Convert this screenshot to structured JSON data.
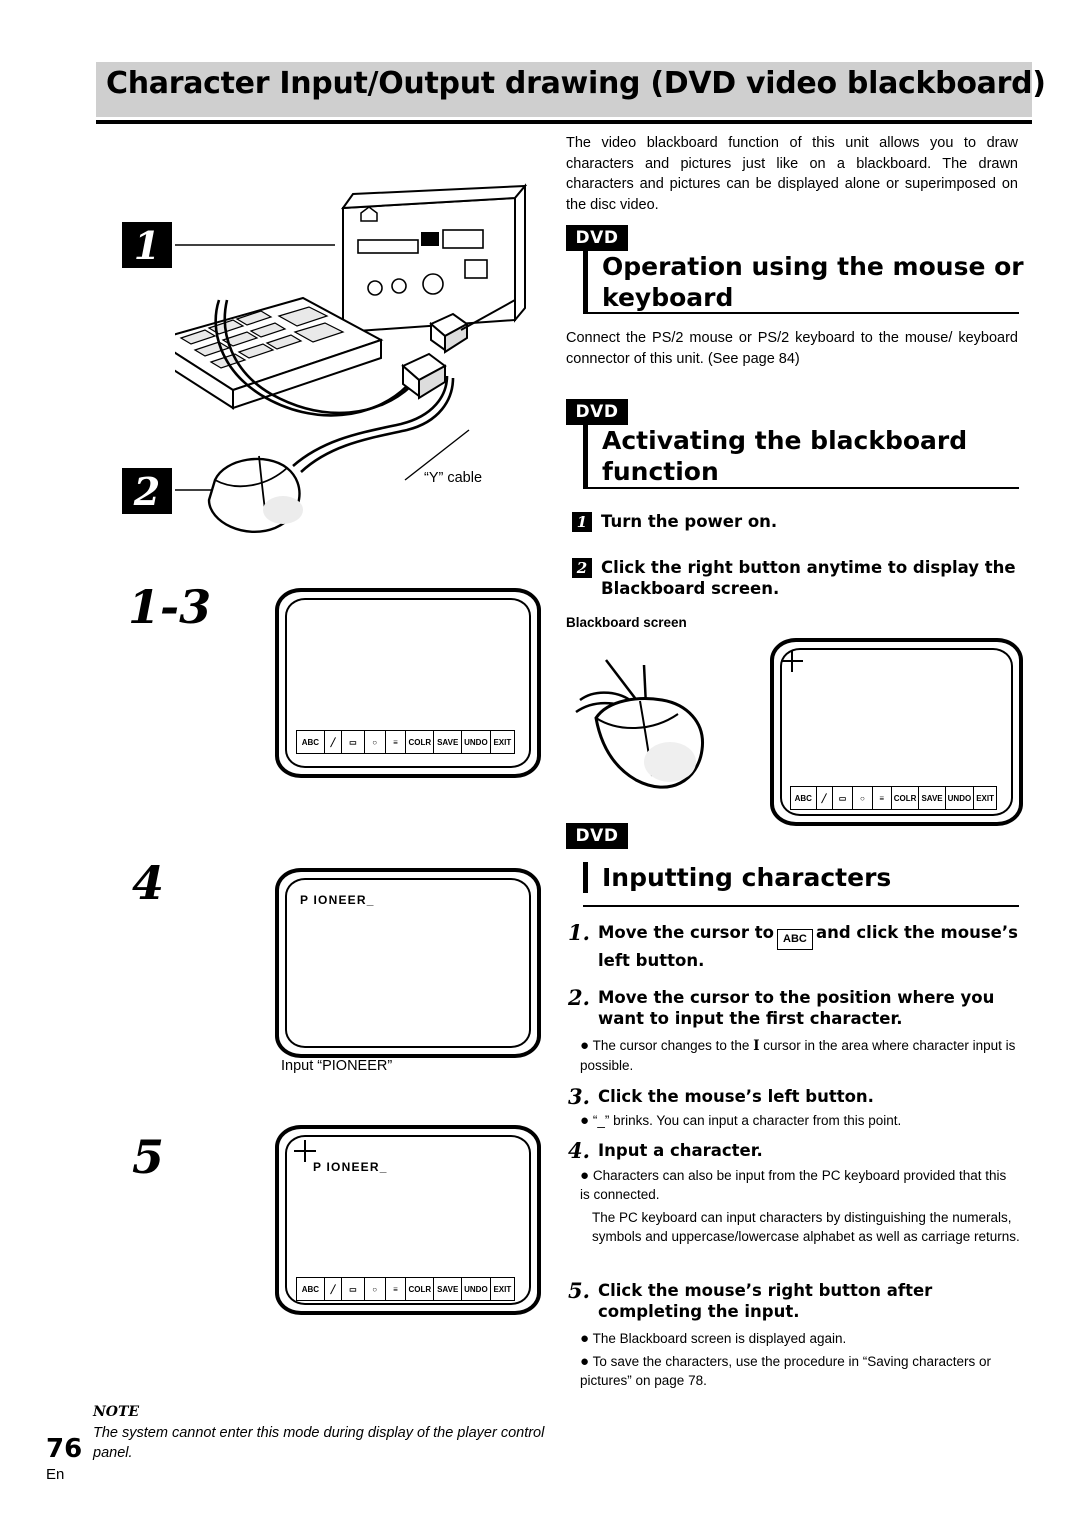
{
  "header": {
    "title": "Character Input/Output drawing (DVD video blackboard)"
  },
  "intro": "The video blackboard function of this unit allows you to draw characters and pictures just like on a blackboard. The drawn characters and pictures can be displayed alone or superimposed on the disc video.",
  "sections": [
    {
      "badge": "DVD",
      "heading": "Operation using the mouse or keyboard",
      "body": "Connect the PS/2 mouse or PS/2 keyboard to the mouse/ keyboard connector of this unit. (See page 84)"
    },
    {
      "badge": "DVD",
      "heading": "Activating the blackboard function",
      "steps": [
        {
          "num": "1",
          "text": "Turn the power on."
        },
        {
          "num": "2",
          "text": "Click the right button anytime to display the Blackboard screen."
        }
      ],
      "caption": "Blackboard screen"
    },
    {
      "badge": "DVD",
      "heading": "Inputting characters",
      "steps": [
        {
          "num": "1.",
          "text_a": "Move the cursor to",
          "icon": "ABC",
          "text_b": "and click the mouse’s left button."
        },
        {
          "num": "2.",
          "text": "Move the cursor to the position where you want to input the first character.",
          "bullets": [
            {
              "pre": "The cursor changes to the",
              "icon": "I",
              "post": "cursor in the area where character input is possible."
            }
          ]
        },
        {
          "num": "3.",
          "text": "Click the mouse’s left button.",
          "bullets": [
            {
              "pre": "“_” brinks. You can input a character from this point.",
              "icon": "",
              "post": ""
            }
          ]
        },
        {
          "num": "4.",
          "text": "Input a character.",
          "bullets": [
            {
              "pre": "Characters can also be input from the PC keyboard provided that this is connected.",
              "icon": "",
              "post": ""
            }
          ],
          "extra": "The PC keyboard can input characters by distinguishing the numerals, symbols and uppercase/lowercase alphabet as well as carriage returns."
        },
        {
          "num": "5.",
          "text": "Click the mouse’s right button after completing the input.",
          "bullets": [
            {
              "pre": "The Blackboard screen is displayed again.",
              "icon": "",
              "post": ""
            },
            {
              "pre": "To save the characters, use the procedure in “Saving characters or pictures” on page 78.",
              "icon": "",
              "post": ""
            }
          ]
        }
      ]
    }
  ],
  "left_figures": {
    "step1_label": "1",
    "step2_label": "2",
    "step13_label": "1-3",
    "step4_label": "4",
    "step5_label": "5",
    "y_cable_label": "“Y” cable",
    "input_pioneer_caption": "Input “PIONEER”",
    "pioneer_text": "P IONEER_"
  },
  "toolbar_cells": [
    "ABC",
    "╱",
    "▭",
    "○",
    "≡",
    "COLR",
    "SAVE",
    "UNDO",
    "EXIT"
  ],
  "note": {
    "label": "NOTE",
    "text": "The system cannot enter this mode during display of the player control panel."
  },
  "footer": {
    "page": "76",
    "lang": "En"
  }
}
